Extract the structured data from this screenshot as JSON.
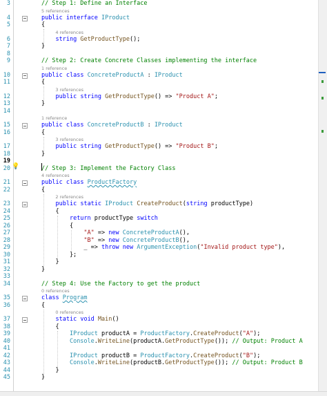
{
  "lines": [
    {
      "n": "3",
      "text": "    // Step 1: Define an Interface"
    },
    {
      "n": "4",
      "text": "    public interface IProduct"
    },
    {
      "n": "5",
      "text": "    {"
    },
    {
      "n": "6",
      "text": "        string GetProductType();"
    },
    {
      "n": "7",
      "text": "    }"
    },
    {
      "n": "8",
      "text": ""
    },
    {
      "n": "9",
      "text": "    // Step 2: Create Concrete Classes implementing the interface"
    },
    {
      "n": "10",
      "text": "    public class ConcreteProductA : IProduct"
    },
    {
      "n": "11",
      "text": "    {"
    },
    {
      "n": "12",
      "text": "        public string GetProductType() => \"Product A\";"
    },
    {
      "n": "13",
      "text": "    }"
    },
    {
      "n": "14",
      "text": ""
    },
    {
      "n": "15",
      "text": "    public class ConcreteProductB : IProduct"
    },
    {
      "n": "16",
      "text": "    {"
    },
    {
      "n": "17",
      "text": "        public string GetProductType() => \"Product B\";"
    },
    {
      "n": "18",
      "text": "    }"
    },
    {
      "n": "19",
      "text": ""
    },
    {
      "n": "20",
      "text": "    // Step 3: Implement the Factory Class"
    },
    {
      "n": "21",
      "text": "    public class ProductFactory"
    },
    {
      "n": "22",
      "text": "    {"
    },
    {
      "n": "23",
      "text": "        public static IProduct CreateProduct(string productType)"
    },
    {
      "n": "24",
      "text": "        {"
    },
    {
      "n": "25",
      "text": "            return productType switch"
    },
    {
      "n": "26",
      "text": "            {"
    },
    {
      "n": "27",
      "text": "                \"A\" => new ConcreteProductA(),"
    },
    {
      "n": "28",
      "text": "                \"B\" => new ConcreteProductB(),"
    },
    {
      "n": "29",
      "text": "                _ => throw new ArgumentException(\"Invalid product type\"),"
    },
    {
      "n": "30",
      "text": "            };"
    },
    {
      "n": "31",
      "text": "        }"
    },
    {
      "n": "32",
      "text": "    }"
    },
    {
      "n": "33",
      "text": ""
    },
    {
      "n": "34",
      "text": "    // Step 4: Use the Factory to get the product"
    },
    {
      "n": "35",
      "text": "    class Program"
    },
    {
      "n": "36",
      "text": "    {"
    },
    {
      "n": "37",
      "text": "        static void Main()"
    },
    {
      "n": "38",
      "text": "        {"
    },
    {
      "n": "39",
      "text": "            IProduct productA = ProductFactory.CreateProduct(\"A\");"
    },
    {
      "n": "40",
      "text": "            Console.WriteLine(productA.GetProductType()); // Output: Product A"
    },
    {
      "n": "41",
      "text": ""
    },
    {
      "n": "42",
      "text": "            IProduct productB = ProductFactory.CreateProduct(\"B\");"
    },
    {
      "n": "43",
      "text": "            Console.WriteLine(productB.GetProductType()); // Output: Product B"
    },
    {
      "n": "44",
      "text": "        }"
    },
    {
      "n": "45",
      "text": "    }"
    }
  ],
  "references": [
    {
      "before": "4",
      "label": "5 references"
    },
    {
      "before": "6",
      "label": "4 references"
    },
    {
      "before": "10",
      "label": "1 reference"
    },
    {
      "before": "12",
      "label": "3 references"
    },
    {
      "before": "15",
      "label": "1 reference"
    },
    {
      "before": "17",
      "label": "3 references"
    },
    {
      "before": "21",
      "label": "4 references"
    },
    {
      "before": "23",
      "label": "2 references"
    },
    {
      "before": "35",
      "label": "0 references"
    },
    {
      "before": "37",
      "label": "0 references"
    }
  ],
  "fold_lines": [
    "4",
    "10",
    "15",
    "21",
    "23",
    "35",
    "37"
  ],
  "current_line": "19",
  "colors": {
    "keyword": "#0000ff",
    "type": "#2b91af",
    "comment": "#008000",
    "string": "#a31515",
    "method": "#74531f",
    "line_number": "#2b91af",
    "scroll_mark_blue": "#1f5fbf",
    "scroll_mark_green": "#3a9b3a"
  }
}
